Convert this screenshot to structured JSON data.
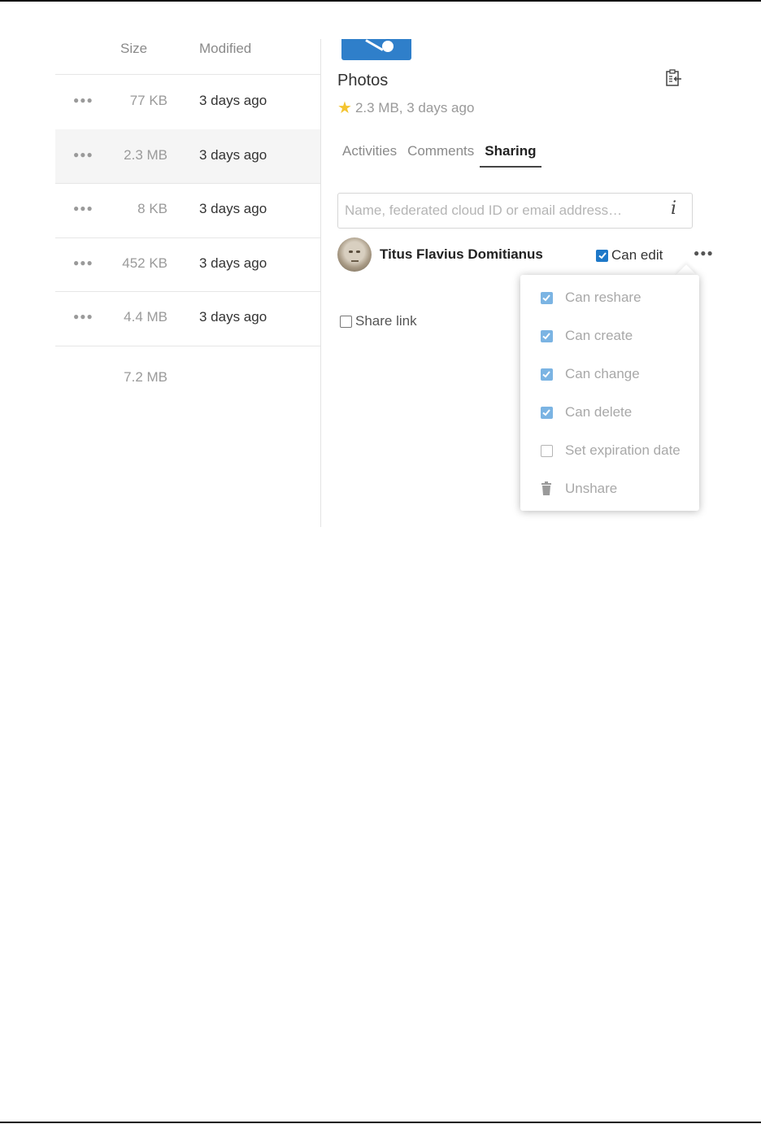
{
  "file_list": {
    "headers": {
      "size": "Size",
      "modified": "Modified"
    },
    "rows": [
      {
        "size": "77 KB",
        "modified": "3 days ago",
        "selected": false
      },
      {
        "size": "2.3 MB",
        "modified": "3 days ago",
        "selected": true
      },
      {
        "size": "8 KB",
        "modified": "3 days ago",
        "selected": false
      },
      {
        "size": "452 KB",
        "modified": "3 days ago",
        "selected": false
      },
      {
        "size": "4.4 MB",
        "modified": "3 days ago",
        "selected": false
      }
    ],
    "row_menu_icon": "more-dots-icon",
    "total_size": "7.2 MB"
  },
  "sidebar": {
    "title": "Photos",
    "meta": "2.3 MB, 3 days ago",
    "favorite": true,
    "tabs": [
      {
        "label": "Activities",
        "active": false
      },
      {
        "label": "Comments",
        "active": false
      },
      {
        "label": "Sharing",
        "active": true
      }
    ],
    "share_input": {
      "placeholder": "Name, federated cloud ID or email address…",
      "value": ""
    },
    "share": {
      "user_name": "Titus Flavius Domitianus",
      "can_edit_label": "Can edit",
      "can_edit_checked": true
    },
    "share_link_label": "Share link",
    "share_link_checked": false
  },
  "permissions_menu": {
    "items": [
      {
        "label": "Can reshare",
        "checked": true,
        "icon": "checkbox"
      },
      {
        "label": "Can create",
        "checked": true,
        "icon": "checkbox"
      },
      {
        "label": "Can change",
        "checked": true,
        "icon": "checkbox"
      },
      {
        "label": "Can delete",
        "checked": true,
        "icon": "checkbox"
      },
      {
        "label": "Set expiration date",
        "checked": false,
        "icon": "checkbox"
      },
      {
        "label": "Unshare",
        "icon": "trash-icon"
      }
    ]
  },
  "colors": {
    "accent": "#1e78c8",
    "accent_light": "#7bb4e3",
    "favorite_star": "#f4c430",
    "folder_thumb": "#2f7fca"
  }
}
